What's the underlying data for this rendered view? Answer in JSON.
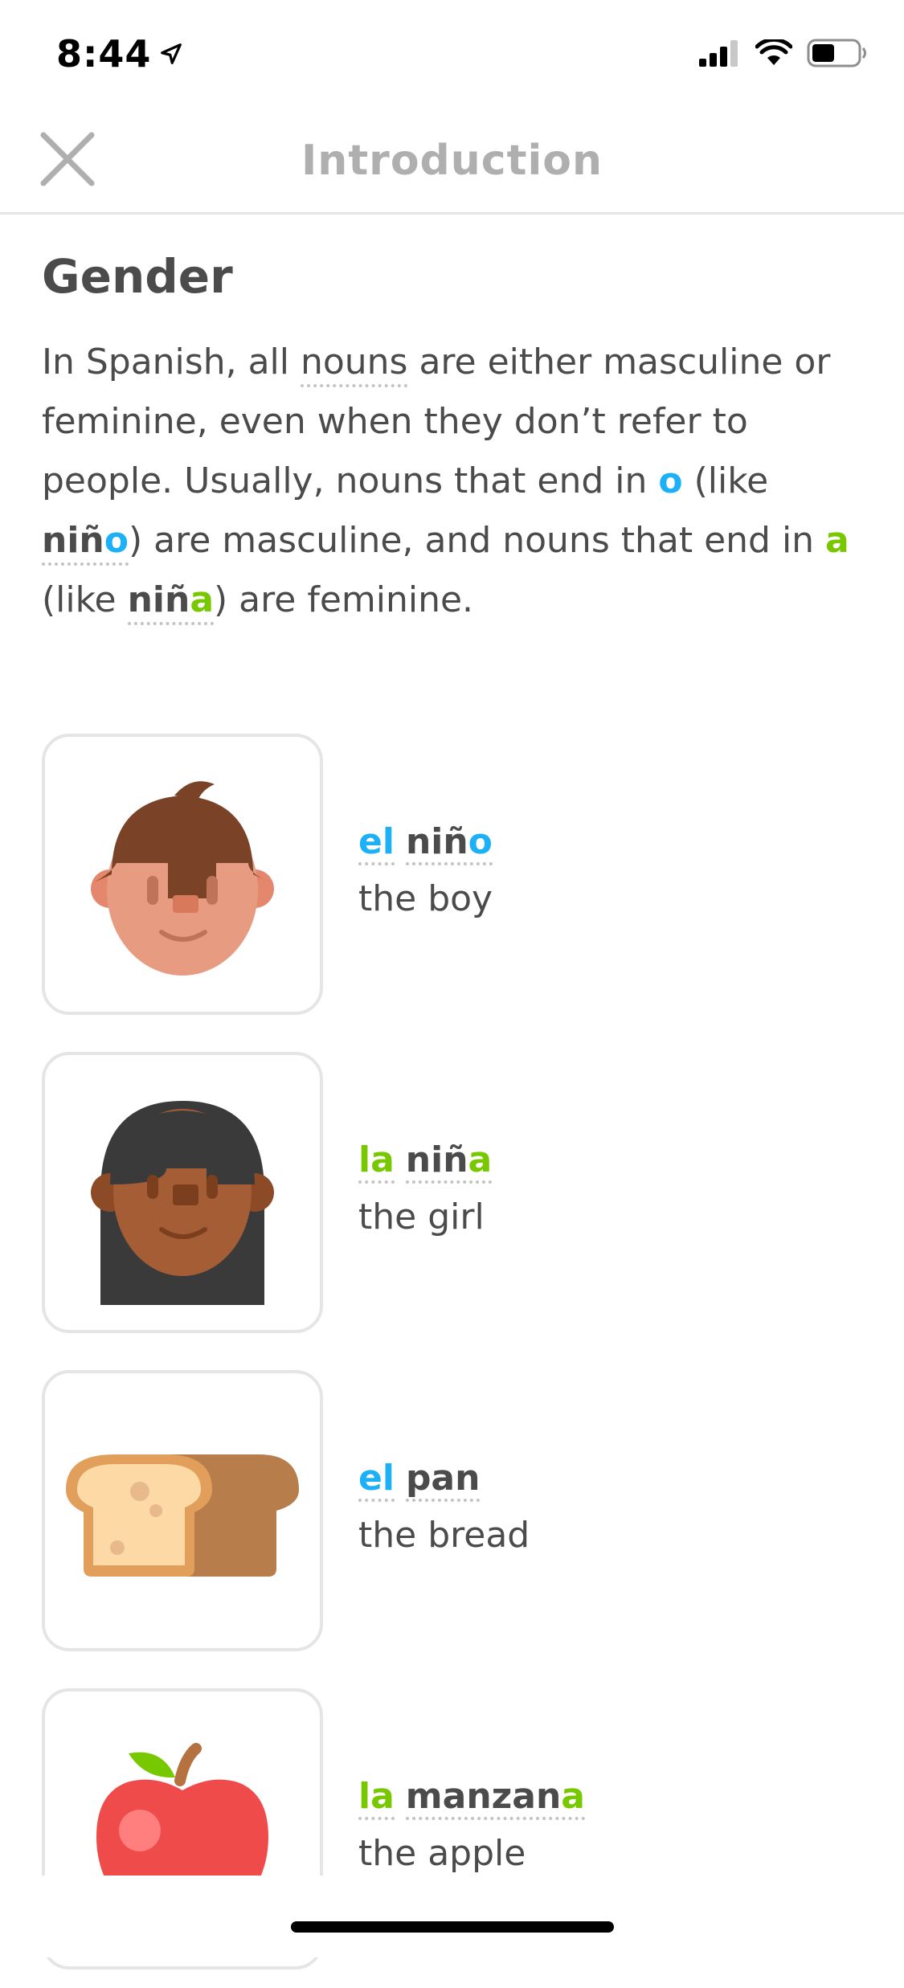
{
  "status": {
    "time": "8:44"
  },
  "header": {
    "title": "Introduction"
  },
  "lesson": {
    "section_title": "Gender",
    "intro": {
      "p1": "In Spanish, all ",
      "nouns": "nouns",
      "p2": " are either masculine or feminine, even when they don’t refer to people. Usually, nouns that end in ",
      "o": "o",
      "p3": " (like ",
      "nino_stem": "niñ",
      "nino_end": "o",
      "p4": ") are masculine, and nouns that end in ",
      "a": "a",
      "p5": " (like ",
      "nina_stem": "niñ",
      "nina_end": "a",
      "p6": ") are feminine."
    },
    "cards": [
      {
        "article": "el",
        "stem": "niñ",
        "ending": "o",
        "translation": "the boy",
        "gender_color": "#1cb0f6",
        "icon": "boy-face-icon"
      },
      {
        "article": "la",
        "stem": "niñ",
        "ending": "a",
        "translation": "the girl",
        "gender_color": "#78c800",
        "icon": "girl-face-icon"
      },
      {
        "article": "el",
        "stem": "pan",
        "ending": "",
        "translation": "the bread",
        "gender_color": "#1cb0f6",
        "icon": "bread-icon"
      },
      {
        "article": "la",
        "stem": "manzan",
        "ending": "a",
        "translation": "the apple",
        "gender_color": "#78c800",
        "icon": "apple-icon"
      }
    ]
  },
  "colors": {
    "masculine": "#1cb0f6",
    "feminine": "#78c800",
    "text": "#4b4b4b",
    "muted": "#afafaf",
    "border": "#e5e5e5"
  }
}
